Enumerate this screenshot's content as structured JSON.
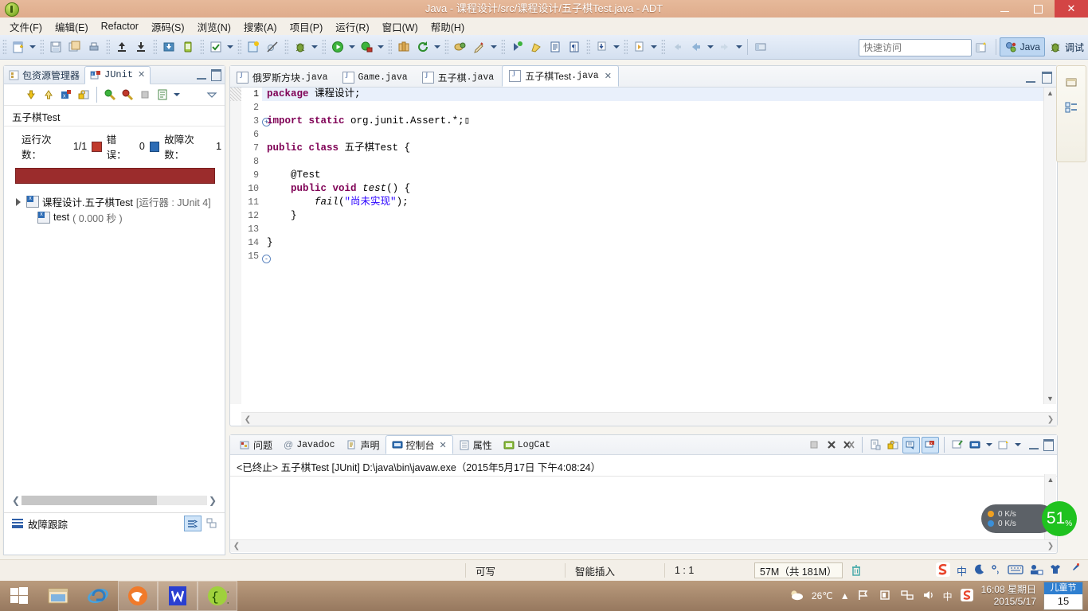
{
  "window": {
    "title": "Java - 课程设计/src/课程设计/五子棋Test.java - ADT",
    "minimize": "—",
    "maximize": "❐",
    "close": "✕"
  },
  "menu": [
    {
      "label": "文件(F)"
    },
    {
      "label": "编辑(E)"
    },
    {
      "label": "Refactor"
    },
    {
      "label": "源码(S)"
    },
    {
      "label": "浏览(N)"
    },
    {
      "label": "搜索(A)"
    },
    {
      "label": "项目(P)"
    },
    {
      "label": "运行(R)"
    },
    {
      "label": "窗口(W)"
    },
    {
      "label": "帮助(H)"
    }
  ],
  "toolbar": {
    "quick_access_placeholder": "快速访问",
    "quick_access_value": "",
    "perspectives": [
      {
        "label": "Java",
        "active": true
      },
      {
        "label": "调试",
        "active": false
      }
    ]
  },
  "junit_view": {
    "tabs": [
      {
        "label": "包资源管理器",
        "active": false
      },
      {
        "label": "JUnit",
        "active": true
      }
    ],
    "close_glyph": "✕",
    "test_name": "五子棋Test",
    "counters": {
      "runs_label": "运行次数：",
      "runs_value": "1/1",
      "errors_label": "错误：",
      "errors_value": "0",
      "failures_label": "故障次数：",
      "failures_value": "1"
    },
    "tree": [
      {
        "label": "课程设计.五子棋Test",
        "suffix": "[运行器 : JUnit 4]",
        "level": 0,
        "expanded": true
      },
      {
        "label": "test",
        "suffix": "( 0.000 秒 )",
        "level": 1,
        "expanded": false
      }
    ],
    "failure_trace_label": "故障跟踪"
  },
  "editor": {
    "tabs": [
      {
        "label": "俄罗斯方块",
        "ext": ".java",
        "active": false
      },
      {
        "label": "Game",
        "ext": ".java",
        "active": false
      },
      {
        "label": "五子棋",
        "ext": ".java",
        "active": false
      },
      {
        "label": "五子棋Test",
        "ext": ".java",
        "active": true
      }
    ],
    "close_glyph": "✕",
    "lines": [
      {
        "num": "1",
        "fold": "",
        "current": true,
        "html": "<span class='kw'>package</span> 课程设计;"
      },
      {
        "num": "2",
        "fold": "",
        "current": false,
        "html": ""
      },
      {
        "num": "3",
        "fold": "+",
        "current": false,
        "html": "<span class='kw'>import</span> <span class='kw'>static</span> org.junit.Assert.*;▯"
      },
      {
        "num": "6",
        "fold": "",
        "current": false,
        "html": ""
      },
      {
        "num": "7",
        "fold": "",
        "current": false,
        "html": "<span class='kw'>public</span> <span class='kw'>class</span> 五子棋Test {"
      },
      {
        "num": "8",
        "fold": "",
        "current": false,
        "html": ""
      },
      {
        "num": "9",
        "fold": "-",
        "current": false,
        "html": "    @Test"
      },
      {
        "num": "10",
        "fold": "",
        "current": false,
        "html": "    <span class='kw'>public</span> <span class='kw'>void</span> <span class='ital'>test</span>() {"
      },
      {
        "num": "11",
        "fold": "",
        "current": false,
        "html": "        <span class='ital'>fail</span>(<span class='str'>\"尚未实现\"</span>);"
      },
      {
        "num": "12",
        "fold": "",
        "current": false,
        "html": "    }"
      },
      {
        "num": "13",
        "fold": "",
        "current": false,
        "html": ""
      },
      {
        "num": "14",
        "fold": "",
        "current": false,
        "html": "}"
      },
      {
        "num": "15",
        "fold": "",
        "current": false,
        "html": ""
      }
    ]
  },
  "console": {
    "tabs": [
      {
        "label": "问题",
        "active": false
      },
      {
        "label": "Javadoc",
        "active": false
      },
      {
        "label": "声明",
        "active": false
      },
      {
        "label": "控制台",
        "active": true
      },
      {
        "label": "属性",
        "active": false
      },
      {
        "label": "LogCat",
        "active": false
      }
    ],
    "close_glyph": "✕",
    "output": "<已终止> 五子棋Test [JUnit] D:\\java\\bin\\javaw.exe（2015年5月17日 下午4:08:24）"
  },
  "status_bar": {
    "writable": "可写",
    "insert_mode": "智能插入",
    "position": "1 : 1",
    "memory": "57M（共 181M）",
    "ime_lang": "中"
  },
  "net_widget": {
    "upload": "0 K/s",
    "download": "0 K/s",
    "percent": "51",
    "percent_unit": "%"
  },
  "taskbar": {
    "temperature": "26℃",
    "ime": "中",
    "time": "16:08 星期日",
    "date": "2015/5/17",
    "calendar_top": "儿童节",
    "calendar_day": "15"
  },
  "colors": {
    "title_bar": "#e0ad8d",
    "close_button": "#d34545",
    "failure_bar": "#9b2c2c",
    "keyword": "#7f0055",
    "string": "#2a00ff",
    "accent_blue": "#2d6cb5",
    "net_green": "#1fc21f"
  }
}
